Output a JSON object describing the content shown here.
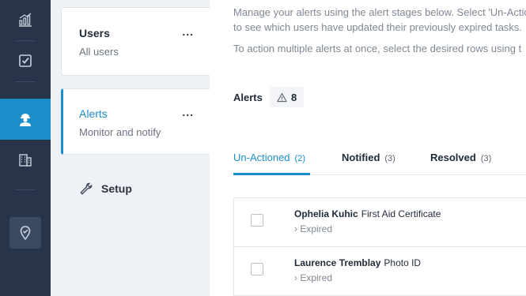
{
  "rail": {
    "items": [
      "analytics-icon",
      "checklist-icon",
      "worker-icon",
      "buildings-icon",
      "map-pin-icon"
    ],
    "active": "worker-icon"
  },
  "colors": {
    "accent": "#1b8ec9",
    "rail_bg": "#27344a"
  },
  "subnav": {
    "users": {
      "title": "Users",
      "subtitle": "All users",
      "more": "..."
    },
    "alerts": {
      "title": "Alerts",
      "subtitle": "Monitor and notify",
      "more": "..."
    },
    "setup": {
      "label": "Setup"
    }
  },
  "main": {
    "intro_line1": "Manage your alerts using the alert stages below. Select 'Un-Actic",
    "intro_line2": "to see which users have updated their previously expired tasks.",
    "intro_line3": "To action multiple alerts at once, select the desired rows using t",
    "alerts_label": "Alerts",
    "alerts_count": "8",
    "tabs": [
      {
        "label": "Un-Actioned",
        "count": "(2)"
      },
      {
        "label": "Notified",
        "count": "(3)"
      },
      {
        "label": "Resolved",
        "count": "(3)"
      }
    ],
    "rows": [
      {
        "name": "Ophelia Kuhic",
        "document": "First Aid Certificate",
        "status": "› Expired"
      },
      {
        "name": "Laurence Tremblay",
        "document": "Photo ID",
        "status": "› Expired"
      }
    ]
  }
}
